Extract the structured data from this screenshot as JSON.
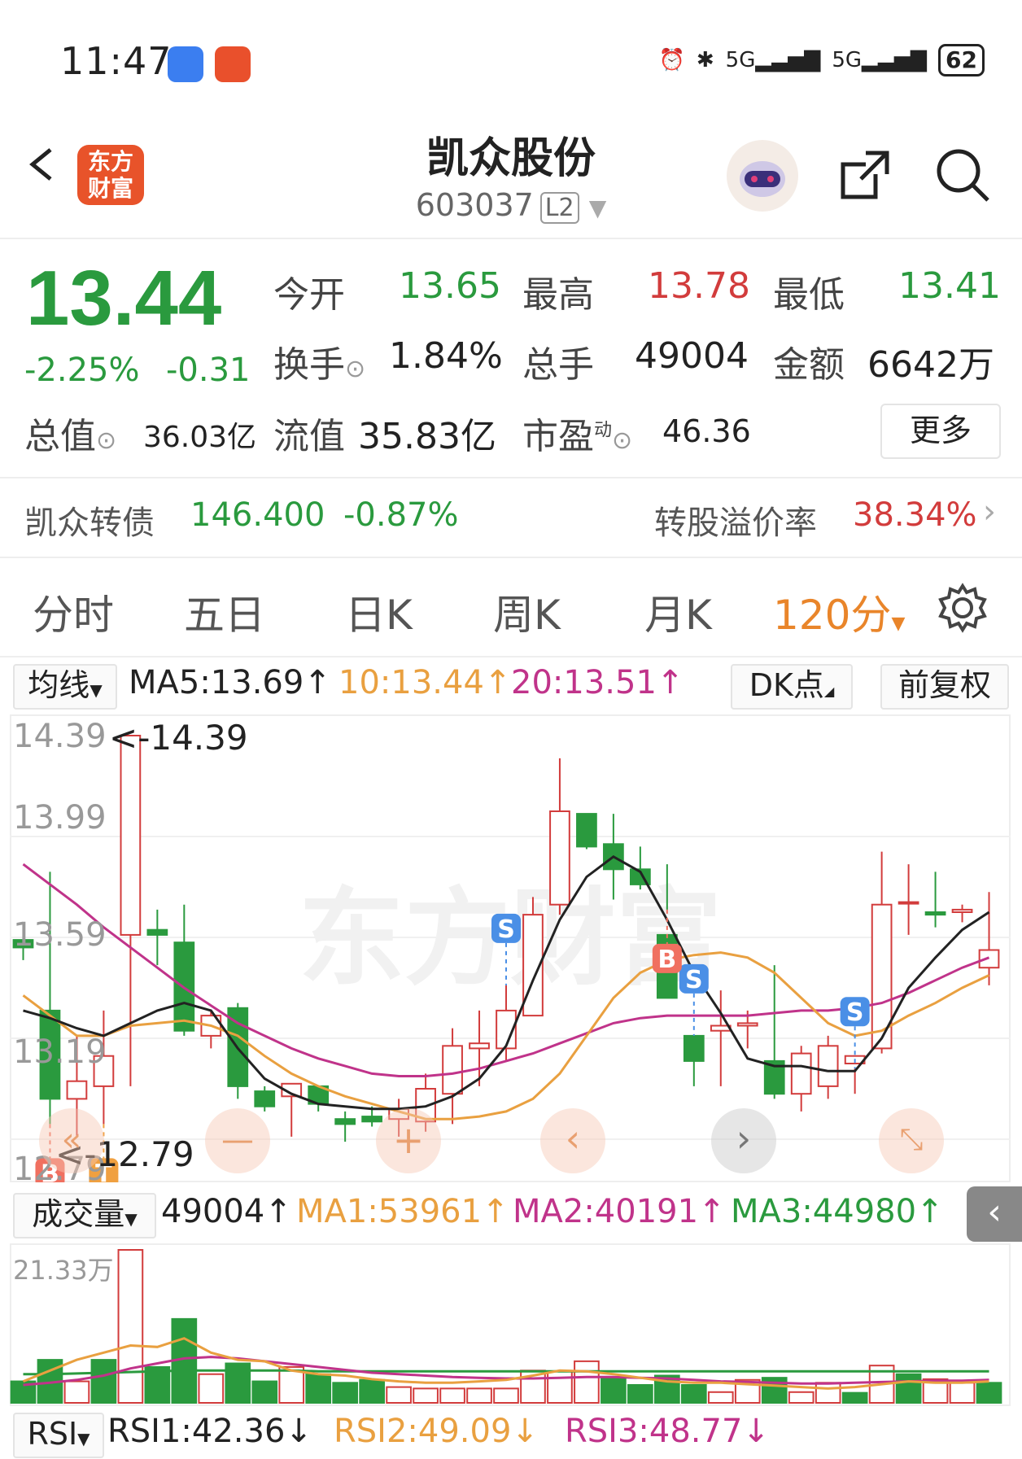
{
  "status_bar": {
    "time": "11:47",
    "network1": "5G",
    "network2": "5G",
    "battery": "62"
  },
  "header": {
    "brand_line1": "东方",
    "brand_line2": "财富",
    "title": "凯众股份",
    "code": "603037",
    "level": "L2"
  },
  "quote": {
    "price": "13.44",
    "change_pct": "-2.25%",
    "change_amt": "-0.31",
    "open_label": "今开",
    "open": "13.65",
    "high_label": "最高",
    "high": "13.78",
    "low_label": "最低",
    "low": "13.41",
    "turnover_label": "换手",
    "turnover": "1.84%",
    "volume_label": "总手",
    "volume": "49004",
    "amount_label": "金额",
    "amount": "6642万",
    "mcap_label": "总值",
    "mcap": "36.03亿",
    "float_label": "流值",
    "float_cap": "35.83亿",
    "pe_label": "市盈",
    "pe_sup": "动",
    "pe": "46.36",
    "more": "更多"
  },
  "bond": {
    "name": "凯众转债",
    "price": "146.400",
    "change": "-0.87%",
    "premium_label": "转股溢价率",
    "premium": "38.34%"
  },
  "tabs": [
    {
      "label": "分时"
    },
    {
      "label": "五日"
    },
    {
      "label": "日K"
    },
    {
      "label": "周K"
    },
    {
      "label": "月K"
    },
    {
      "label": "120分"
    }
  ],
  "ma_bar": {
    "selector": "均线",
    "ma5": "MA5:13.69↑",
    "ma10": "10:13.44↑",
    "ma20": "20:13.51↑",
    "dk": "DK点",
    "adjust": "前复权"
  },
  "vol_bar": {
    "selector": "成交量",
    "value": "49004↑",
    "ma1": "MA1:53961↑",
    "ma2": "MA2:40191↑",
    "ma3": "MA3:44980↑"
  },
  "rsi_bar": {
    "selector": "RSI",
    "rsi1": "RSI1:42.36↓",
    "rsi2": "RSI2:49.09↓",
    "rsi3": "RSI3:48.77↓"
  },
  "colors": {
    "up": "#d23c3c",
    "down": "#2a9a3e",
    "ma5": "#222222",
    "ma10": "#e9a040",
    "ma20": "#c0338a",
    "accent": "#e9852a"
  },
  "chart_data": {
    "type": "candlestick",
    "y_ticks": [
      "14.39",
      "13.99",
      "13.59",
      "13.19",
      "12.79"
    ],
    "ylim": [
      12.79,
      14.39
    ],
    "max_label": "<-14.39",
    "min_label": "<-12.79",
    "watermark": "东方财富",
    "signals": [
      {
        "label": "B",
        "bar": 1
      },
      {
        "label": "T",
        "bar": 3
      },
      {
        "label": "S",
        "bar": 18
      },
      {
        "label": "S",
        "bar": 25
      },
      {
        "label": "B",
        "bar": 24
      },
      {
        "label": "S",
        "bar": 31
      }
    ],
    "candles": [
      {
        "o": 13.58,
        "h": 13.62,
        "l": 13.5,
        "c": 13.55
      },
      {
        "o": 13.3,
        "h": 13.85,
        "l": 12.85,
        "c": 12.95
      },
      {
        "o": 12.95,
        "h": 13.2,
        "l": 12.8,
        "c": 13.02
      },
      {
        "o": 13.0,
        "h": 13.3,
        "l": 12.85,
        "c": 13.12
      },
      {
        "o": 13.6,
        "h": 14.39,
        "l": 13.0,
        "c": 14.39
      },
      {
        "o": 13.62,
        "h": 13.7,
        "l": 13.48,
        "c": 13.6
      },
      {
        "o": 13.57,
        "h": 13.72,
        "l": 13.2,
        "c": 13.22
      },
      {
        "o": 13.2,
        "h": 13.3,
        "l": 13.15,
        "c": 13.28
      },
      {
        "o": 13.31,
        "h": 13.33,
        "l": 12.95,
        "c": 13.0
      },
      {
        "o": 12.98,
        "h": 13.0,
        "l": 12.9,
        "c": 12.92
      },
      {
        "o": 12.96,
        "h": 13.0,
        "l": 12.8,
        "c": 13.01
      },
      {
        "o": 13.0,
        "h": 13.0,
        "l": 12.9,
        "c": 12.93
      },
      {
        "o": 12.87,
        "h": 12.9,
        "l": 12.78,
        "c": 12.85
      },
      {
        "o": 12.88,
        "h": 12.92,
        "l": 12.84,
        "c": 12.86
      },
      {
        "o": 12.87,
        "h": 12.95,
        "l": 12.8,
        "c": 12.91
      },
      {
        "o": 12.86,
        "h": 13.05,
        "l": 12.82,
        "c": 12.99
      },
      {
        "o": 12.97,
        "h": 13.23,
        "l": 12.85,
        "c": 13.16
      },
      {
        "o": 13.15,
        "h": 13.3,
        "l": 13.0,
        "c": 13.17
      },
      {
        "o": 13.15,
        "h": 13.4,
        "l": 13.1,
        "c": 13.3
      },
      {
        "o": 13.28,
        "h": 13.75,
        "l": 13.28,
        "c": 13.68
      },
      {
        "o": 13.72,
        "h": 14.3,
        "l": 13.68,
        "c": 14.09
      },
      {
        "o": 14.08,
        "h": 14.0,
        "l": 13.94,
        "c": 13.95
      },
      {
        "o": 13.96,
        "h": 14.08,
        "l": 13.74,
        "c": 13.86
      },
      {
        "o": 13.86,
        "h": 13.95,
        "l": 13.78,
        "c": 13.8
      },
      {
        "o": 13.6,
        "h": 13.88,
        "l": 13.7,
        "c": 13.35
      },
      {
        "o": 13.2,
        "h": 13.2,
        "l": 13.0,
        "c": 13.1
      },
      {
        "o": 13.22,
        "h": 13.38,
        "l": 13.0,
        "c": 13.24
      },
      {
        "o": 13.24,
        "h": 13.3,
        "l": 13.15,
        "c": 13.25
      },
      {
        "o": 13.1,
        "h": 13.48,
        "l": 12.95,
        "c": 12.97
      },
      {
        "o": 12.97,
        "h": 13.16,
        "l": 12.9,
        "c": 13.13
      },
      {
        "o": 13.0,
        "h": 13.2,
        "l": 12.95,
        "c": 13.16
      },
      {
        "o": 13.09,
        "h": 13.07,
        "l": 12.97,
        "c": 13.12
      },
      {
        "o": 13.15,
        "h": 13.93,
        "l": 13.13,
        "c": 13.72
      },
      {
        "o": 13.73,
        "h": 13.88,
        "l": 13.6,
        "c": 13.73
      },
      {
        "o": 13.69,
        "h": 13.85,
        "l": 13.63,
        "c": 13.68
      },
      {
        "o": 13.69,
        "h": 13.72,
        "l": 13.65,
        "c": 13.7
      },
      {
        "o": 13.47,
        "h": 13.77,
        "l": 13.4,
        "c": 13.54
      }
    ],
    "ma5": [
      13.3,
      13.27,
      13.23,
      13.2,
      13.25,
      13.3,
      13.33,
      13.3,
      13.15,
      13.03,
      12.97,
      12.93,
      12.92,
      12.91,
      12.91,
      12.92,
      12.96,
      13.03,
      13.16,
      13.42,
      13.66,
      13.83,
      13.91,
      13.85,
      13.66,
      13.45,
      13.29,
      13.11,
      13.08,
      13.08,
      13.06,
      13.06,
      13.19,
      13.39,
      13.51,
      13.62,
      13.69
    ],
    "ma10": [
      13.36,
      13.28,
      13.2,
      13.2,
      13.24,
      13.25,
      13.26,
      13.24,
      13.2,
      13.12,
      13.05,
      13.0,
      12.96,
      12.93,
      12.9,
      12.87,
      12.87,
      12.88,
      12.9,
      12.95,
      13.05,
      13.2,
      13.35,
      13.45,
      13.5,
      13.52,
      13.53,
      13.51,
      13.45,
      13.35,
      13.25,
      13.2,
      13.22,
      13.28,
      13.33,
      13.39,
      13.44
    ],
    "ma20": [
      13.88,
      13.8,
      13.72,
      13.63,
      13.55,
      13.47,
      13.39,
      13.32,
      13.25,
      13.2,
      13.15,
      13.11,
      13.08,
      13.05,
      13.04,
      13.04,
      13.05,
      13.07,
      13.1,
      13.13,
      13.17,
      13.21,
      13.25,
      13.27,
      13.28,
      13.28,
      13.28,
      13.28,
      13.29,
      13.3,
      13.3,
      13.31,
      13.33,
      13.37,
      13.42,
      13.47,
      13.51
    ],
    "volume": {
      "max_label": "21.33万",
      "max": 213300,
      "bars": [
        30000,
        60000,
        30000,
        60000,
        213300,
        50000,
        117000,
        40000,
        55000,
        30000,
        50000,
        40000,
        28000,
        32000,
        22000,
        20000,
        20000,
        20000,
        20000,
        45000,
        44000,
        58000,
        35000,
        25000,
        38000,
        25000,
        15000,
        32000,
        35000,
        15000,
        28000,
        14000,
        52000,
        40000,
        33000,
        28000,
        28000
      ],
      "up": [
        false,
        false,
        true,
        false,
        true,
        false,
        false,
        true,
        false,
        false,
        true,
        false,
        false,
        false,
        true,
        true,
        true,
        true,
        true,
        true,
        true,
        true,
        false,
        false,
        false,
        false,
        true,
        true,
        false,
        true,
        true,
        false,
        true,
        false,
        true,
        true,
        false
      ],
      "ma1": [
        30000,
        45000,
        60000,
        70000,
        80000,
        78000,
        90000,
        70000,
        60000,
        58000,
        45000,
        40000,
        38000,
        33000,
        30000,
        28000,
        28000,
        30000,
        32000,
        38000,
        45000,
        44000,
        40000,
        35000,
        30000,
        28000,
        28000,
        26000,
        24000,
        22000,
        20000,
        22000,
        26000,
        30000,
        28000,
        28000,
        30000
      ],
      "ma2": [
        25000,
        28000,
        32000,
        38000,
        48000,
        55000,
        62000,
        64000,
        62000,
        58000,
        54000,
        50000,
        46000,
        42000,
        40000,
        38000,
        36000,
        35000,
        34000,
        34000,
        35000,
        36000,
        36000,
        35000,
        34000,
        32000,
        30000,
        29000,
        28000,
        27000,
        27000,
        28000,
        29000,
        30000,
        31000,
        31000,
        32000
      ],
      "ma3": [
        40000,
        40000,
        41000,
        42000,
        43000,
        44000,
        45000,
        45000,
        45000,
        45000,
        45000,
        44000,
        44000,
        44000,
        44000,
        44000,
        44000,
        44000,
        44000,
        44000,
        44000,
        44000,
        44000,
        44000,
        44000,
        44000,
        44000,
        44000,
        44000,
        44000,
        44000,
        44000,
        44000,
        44000,
        44000,
        44000,
        44000
      ]
    }
  }
}
